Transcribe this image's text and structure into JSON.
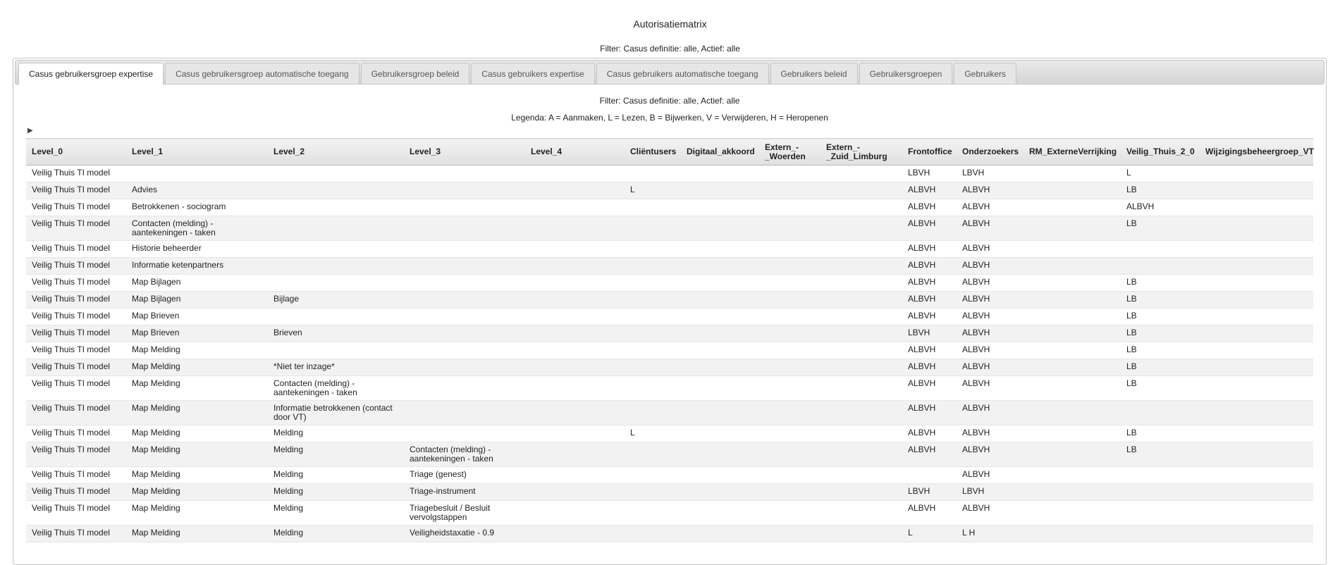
{
  "page": {
    "title": "Autorisatiematrix",
    "filter": "Filter: Casus definitie: alle, Actief: alle"
  },
  "tabs": [
    {
      "label": "Casus gebruikersgroep expertise",
      "active": true
    },
    {
      "label": "Casus gebruikersgroep automatische toegang",
      "active": false
    },
    {
      "label": "Gebruikersgroep beleid",
      "active": false
    },
    {
      "label": "Casus gebruikers expertise",
      "active": false
    },
    {
      "label": "Casus gebruikers automatische toegang",
      "active": false
    },
    {
      "label": "Gebruikers beleid",
      "active": false
    },
    {
      "label": "Gebruikersgroepen",
      "active": false
    },
    {
      "label": "Gebruikers",
      "active": false
    }
  ],
  "panel": {
    "filter": "Filter: Casus definitie: alle, Actief: alle",
    "legend": "Legenda: A = Aanmaken, L = Lezen, B = Bijwerken, V = Verwijderen, H = Heropenen",
    "toggle_icon": "▶"
  },
  "table": {
    "columns": [
      "Level_0",
      "Level_1",
      "Level_2",
      "Level_3",
      "Level_4",
      "Cliëntusers",
      "Digitaal_akkoord",
      "Extern_-\n_Woerden",
      "Extern_-\n_Zuid_Limburg",
      "Frontoffice",
      "Onderzoekers",
      "RM_ExterneVerrijking",
      "Veilig_Thuis_2_0",
      "Wijzigingsbeheergroep_VT"
    ],
    "rows": [
      [
        "Veilig Thuis TI model",
        "",
        "",
        "",
        "",
        "",
        "",
        "",
        "",
        "LBVH",
        "LBVH",
        "",
        "L",
        ""
      ],
      [
        "Veilig Thuis TI model",
        "Advies",
        "",
        "",
        "",
        "L",
        "",
        "",
        "",
        "ALBVH",
        "ALBVH",
        "",
        "LB",
        ""
      ],
      [
        "Veilig Thuis TI model",
        "Betrokkenen - sociogram",
        "",
        "",
        "",
        "",
        "",
        "",
        "",
        "ALBVH",
        "ALBVH",
        "",
        "ALBVH",
        ""
      ],
      [
        "Veilig Thuis TI model",
        "Contacten (melding) - aantekeningen - taken",
        "",
        "",
        "",
        "",
        "",
        "",
        "",
        "ALBVH",
        "ALBVH",
        "",
        "LB",
        ""
      ],
      [
        "Veilig Thuis TI model",
        "Historie beheerder",
        "",
        "",
        "",
        "",
        "",
        "",
        "",
        "ALBVH",
        "ALBVH",
        "",
        "",
        ""
      ],
      [
        "Veilig Thuis TI model",
        "Informatie ketenpartners",
        "",
        "",
        "",
        "",
        "",
        "",
        "",
        "ALBVH",
        "ALBVH",
        "",
        "",
        ""
      ],
      [
        "Veilig Thuis TI model",
        "Map Bijlagen",
        "",
        "",
        "",
        "",
        "",
        "",
        "",
        "ALBVH",
        "ALBVH",
        "",
        "LB",
        ""
      ],
      [
        "Veilig Thuis TI model",
        "Map Bijlagen",
        "Bijlage",
        "",
        "",
        "",
        "",
        "",
        "",
        "ALBVH",
        "ALBVH",
        "",
        "LB",
        ""
      ],
      [
        "Veilig Thuis TI model",
        "Map Brieven",
        "",
        "",
        "",
        "",
        "",
        "",
        "",
        "ALBVH",
        "ALBVH",
        "",
        "LB",
        ""
      ],
      [
        "Veilig Thuis TI model",
        "Map Brieven",
        "Brieven",
        "",
        "",
        "",
        "",
        "",
        "",
        "LBVH",
        "ALBVH",
        "",
        "LB",
        ""
      ],
      [
        "Veilig Thuis TI model",
        "Map Melding",
        "",
        "",
        "",
        "",
        "",
        "",
        "",
        "ALBVH",
        "ALBVH",
        "",
        "LB",
        ""
      ],
      [
        "Veilig Thuis TI model",
        "Map Melding",
        "*Niet ter inzage*",
        "",
        "",
        "",
        "",
        "",
        "",
        "ALBVH",
        "ALBVH",
        "",
        "LB",
        ""
      ],
      [
        "Veilig Thuis TI model",
        "Map Melding",
        "Contacten (melding) - aantekeningen - taken",
        "",
        "",
        "",
        "",
        "",
        "",
        "ALBVH",
        "ALBVH",
        "",
        "LB",
        ""
      ],
      [
        "Veilig Thuis TI model",
        "Map Melding",
        "Informatie betrokkenen (contact door VT)",
        "",
        "",
        "",
        "",
        "",
        "",
        "ALBVH",
        "ALBVH",
        "",
        "",
        ""
      ],
      [
        "Veilig Thuis TI model",
        "Map Melding",
        "Melding",
        "",
        "",
        "L",
        "",
        "",
        "",
        "ALBVH",
        "ALBVH",
        "",
        "LB",
        ""
      ],
      [
        "Veilig Thuis TI model",
        "Map Melding",
        "Melding",
        "Contacten (melding) - aantekeningen - taken",
        "",
        "",
        "",
        "",
        "",
        "ALBVH",
        "ALBVH",
        "",
        "LB",
        ""
      ],
      [
        "Veilig Thuis TI model",
        "Map Melding",
        "Melding",
        "Triage (genest)",
        "",
        "",
        "",
        "",
        "",
        "",
        "ALBVH",
        "",
        "",
        ""
      ],
      [
        "Veilig Thuis TI model",
        "Map Melding",
        "Melding",
        "Triage-instrument",
        "",
        "",
        "",
        "",
        "",
        "LBVH",
        "LBVH",
        "",
        "",
        ""
      ],
      [
        "Veilig Thuis TI model",
        "Map Melding",
        "Melding",
        "Triagebesluit / Besluit vervolgstappen",
        "",
        "",
        "",
        "",
        "",
        "ALBVH",
        "ALBVH",
        "",
        "",
        ""
      ],
      [
        "Veilig Thuis TI model",
        "Map Melding",
        "Melding",
        "Veiligheidstaxatie - 0.9",
        "",
        "",
        "",
        "",
        "",
        "L",
        "L H",
        "",
        "",
        ""
      ]
    ]
  }
}
